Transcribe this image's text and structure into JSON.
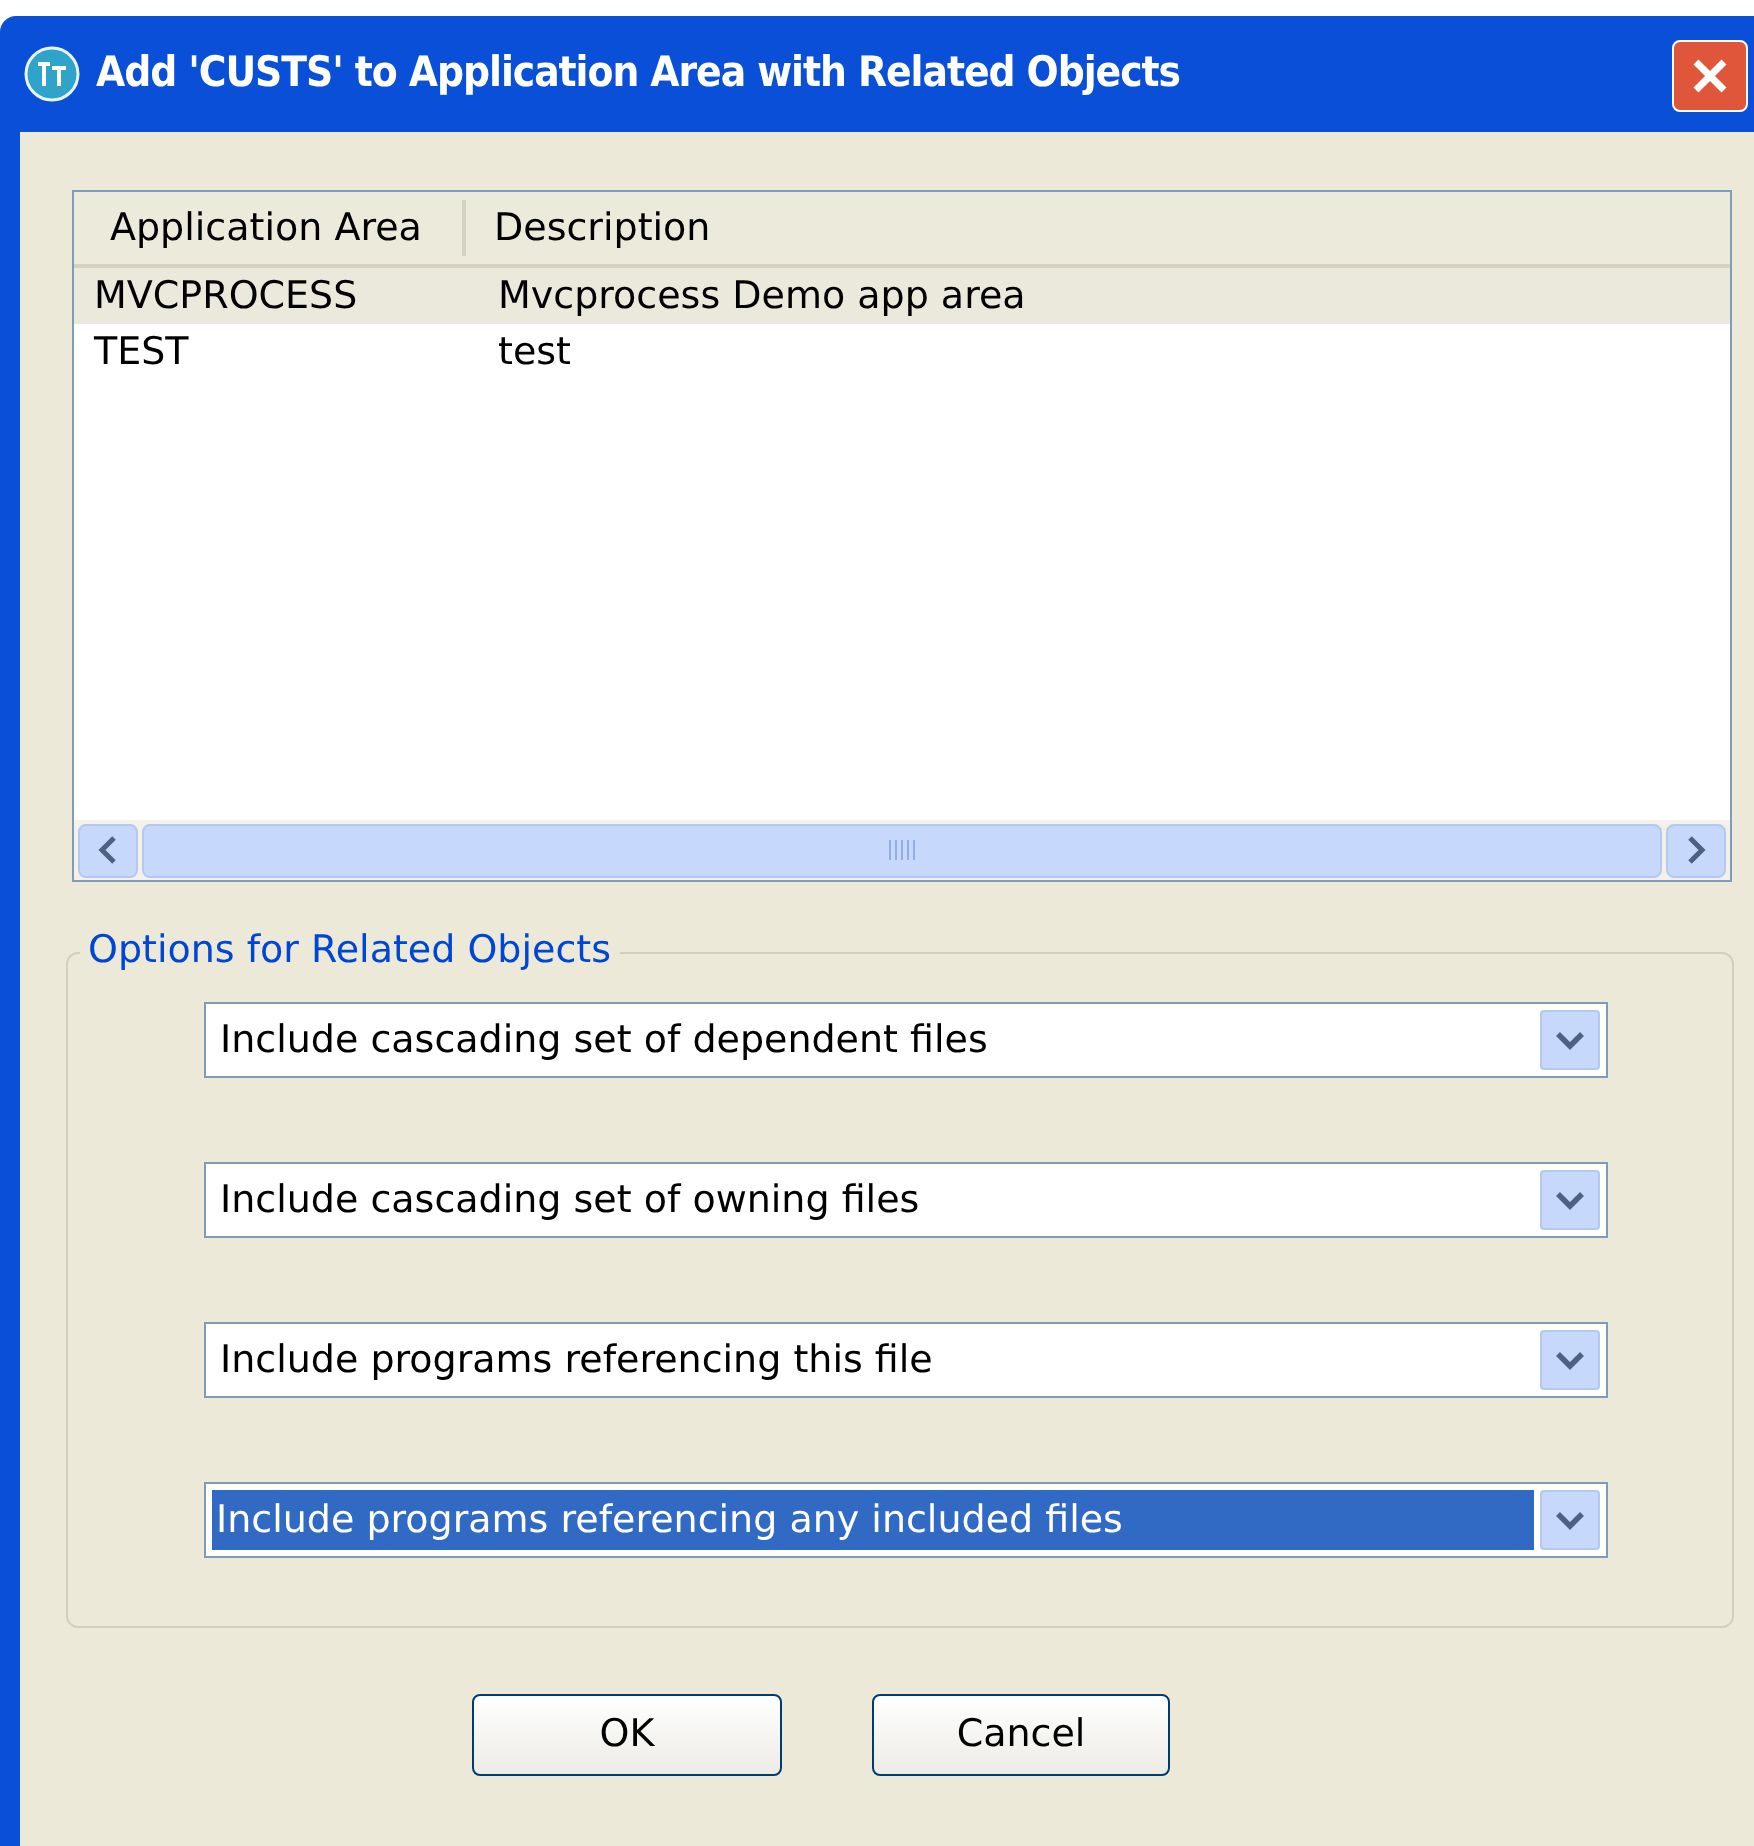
{
  "window": {
    "title": "Add 'CUSTS' to Application Area with Related Objects"
  },
  "table": {
    "columns": [
      "Application Area",
      "Description"
    ],
    "rows": [
      {
        "cells": [
          "MVCPROCESS",
          "Mvcprocess Demo app area"
        ],
        "selected": true
      },
      {
        "cells": [
          "TEST",
          "test"
        ],
        "selected": false
      }
    ]
  },
  "options": {
    "legend": "Options for Related Objects",
    "dropdowns": [
      {
        "value": "Include cascading set of dependent files",
        "focused": false
      },
      {
        "value": "Include cascading set of owning files",
        "focused": false
      },
      {
        "value": "Include programs referencing this file",
        "focused": false
      },
      {
        "value": "Include programs referencing any included files",
        "focused": true
      }
    ]
  },
  "buttons": [
    "OK",
    "Cancel"
  ]
}
